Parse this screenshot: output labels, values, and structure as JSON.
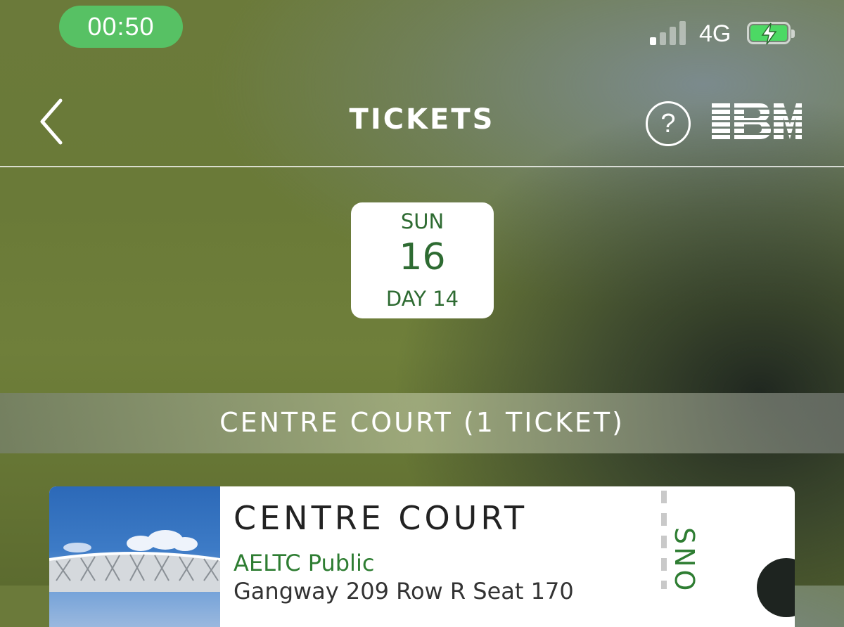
{
  "status_bar": {
    "time": "00:50",
    "network": "4G",
    "signal_bars_active": 1,
    "signal_bars_total": 4,
    "battery_charging": true,
    "colors": {
      "time_pill": "#57c164",
      "battery_fill": "#4cd964"
    }
  },
  "header": {
    "title": "TICKETS",
    "back_icon": "chevron-left-icon",
    "help_label": "?",
    "brand_logo": "IBM"
  },
  "date_selector": {
    "weekday": "SUN",
    "day_number": "16",
    "tournament_day": "DAY 14"
  },
  "section": {
    "label": "CENTRE COURT (1 TICKET)"
  },
  "ticket": {
    "venue": "CENTRE COURT",
    "ticket_type": "AELTC Public",
    "seat_info": "Gangway 209 Row R Seat 170",
    "stub_text": "SNO",
    "accent_color": "#2e7d32"
  }
}
